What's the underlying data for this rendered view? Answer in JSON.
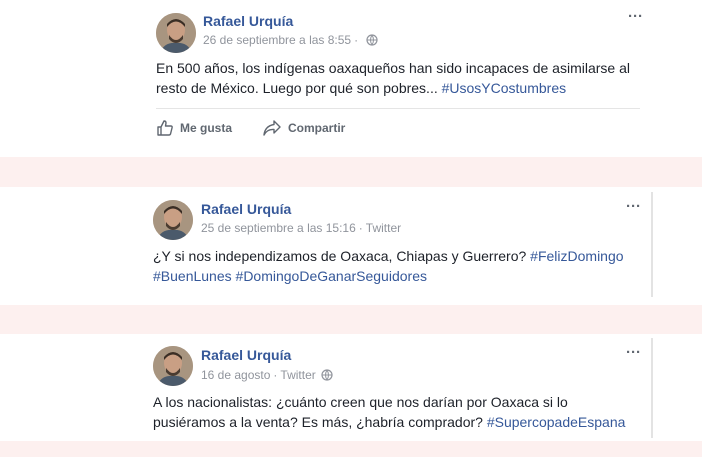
{
  "posts": [
    {
      "author": "Rafael Urquía",
      "date": "26 de septiembre a las 8:55",
      "source": "",
      "text_parts": [
        "En 500 años, los indígenas oaxaqueños han sido incapaces de asimilarse al",
        "resto de México. Luego por qué son pobres... "
      ],
      "hashtags": [
        "#UsosYCostumbres"
      ],
      "actions": {
        "like": "Me gusta",
        "share": "Compartir"
      }
    },
    {
      "author": "Rafael Urquía",
      "date": "25 de septiembre a las 15:16",
      "source": "Twitter",
      "text_parts": [
        "¿Y si nos independizamos de Oaxaca, Chiapas y Guerrero? "
      ],
      "hashtags": [
        "#FelizDomingo",
        "#BuenLunes",
        "#DomingoDeGanarSeguidores"
      ]
    },
    {
      "author": "Rafael Urquía",
      "date": "16 de agosto",
      "source": "Twitter",
      "text_parts": [
        "A los nacionalistas: ¿cuánto creen que nos darían por Oaxaca si lo",
        "pusiéramos a la venta? Es más, ¿habría comprador? "
      ],
      "hashtags": [
        "#SupercopadeEspana"
      ]
    }
  ],
  "icons": {
    "more": "more-options-icon",
    "privacy": "globe-icon",
    "like": "thumbs-up-icon",
    "share": "share-arrow-icon"
  },
  "colors": {
    "link": "#365899",
    "meta": "#90949c",
    "band": "#fdf0ef"
  }
}
